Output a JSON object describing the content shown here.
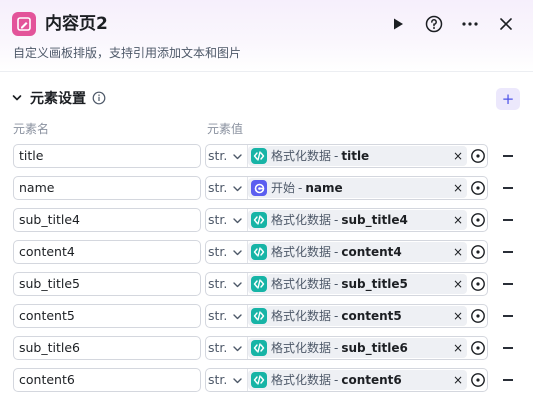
{
  "header": {
    "title": "内容页2",
    "description": "自定义画板排版，支持引用添加文本和图片"
  },
  "section": {
    "title": "元素设置",
    "col_name": "元素名",
    "col_value": "元素值",
    "add_label": "+"
  },
  "rows": [
    {
      "name": "title",
      "type": "str.",
      "source": "格式化数据",
      "sep": "-",
      "var": "title",
      "icon_color": "#17b4a6"
    },
    {
      "name": "name",
      "type": "str.",
      "source": "开始",
      "sep": "-",
      "var": "name",
      "icon_color": "#5b5ef0"
    },
    {
      "name": "sub_title4",
      "type": "str.",
      "source": "格式化数据",
      "sep": "-",
      "var": "sub_title4",
      "icon_color": "#17b4a6"
    },
    {
      "name": "content4",
      "type": "str.",
      "source": "格式化数据",
      "sep": "-",
      "var": "content4",
      "icon_color": "#17b4a6"
    },
    {
      "name": "sub_title5",
      "type": "str.",
      "source": "格式化数据",
      "sep": "-",
      "var": "sub_title5",
      "icon_color": "#17b4a6"
    },
    {
      "name": "content5",
      "type": "str.",
      "source": "格式化数据",
      "sep": "-",
      "var": "content5",
      "icon_color": "#17b4a6"
    },
    {
      "name": "sub_title6",
      "type": "str.",
      "source": "格式化数据",
      "sep": "-",
      "var": "sub_title6",
      "icon_color": "#17b4a6"
    },
    {
      "name": "content6",
      "type": "str.",
      "source": "格式化数据",
      "sep": "-",
      "var": "content6",
      "icon_color": "#17b4a6"
    }
  ],
  "labels": {
    "clear": "×"
  }
}
